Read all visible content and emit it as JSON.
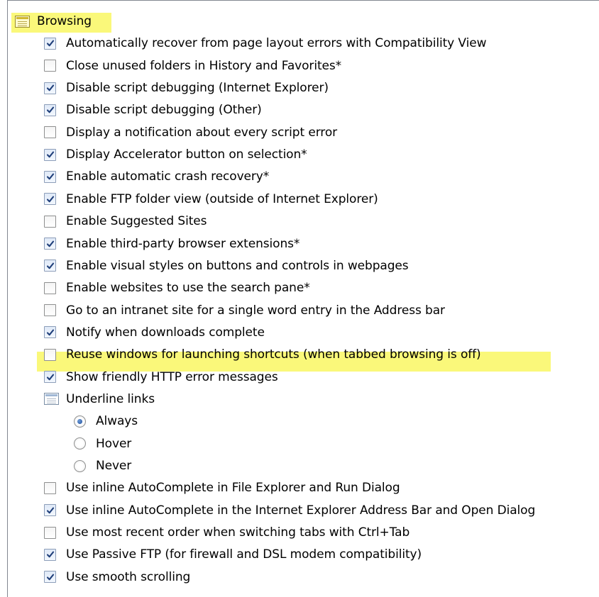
{
  "section": {
    "title": "Browsing",
    "items": [
      {
        "label": "Automatically recover from page layout errors with Compatibility View",
        "checked": true
      },
      {
        "label": "Close unused folders in History and Favorites*",
        "checked": false
      },
      {
        "label": "Disable script debugging (Internet Explorer)",
        "checked": true
      },
      {
        "label": "Disable script debugging (Other)",
        "checked": true
      },
      {
        "label": "Display a notification about every script error",
        "checked": false
      },
      {
        "label": "Display Accelerator button on selection*",
        "checked": true
      },
      {
        "label": "Enable automatic crash recovery*",
        "checked": true
      },
      {
        "label": "Enable FTP folder view (outside of Internet Explorer)",
        "checked": true
      },
      {
        "label": "Enable Suggested Sites",
        "checked": false
      },
      {
        "label": "Enable third-party browser extensions*",
        "checked": true
      },
      {
        "label": "Enable visual styles on buttons and controls in webpages",
        "checked": true
      },
      {
        "label": "Enable websites to use the search pane*",
        "checked": false
      },
      {
        "label": "Go to an intranet site for a single word entry in the Address bar",
        "checked": false
      },
      {
        "label": "Notify when downloads complete",
        "checked": true
      },
      {
        "label": "Reuse windows for launching shortcuts (when tabbed browsing is off)",
        "checked": false,
        "highlighted": true
      },
      {
        "label": "Show friendly HTTP error messages",
        "checked": true
      }
    ],
    "underline_group": {
      "title": "Underline links",
      "options": [
        {
          "label": "Always",
          "selected": true
        },
        {
          "label": "Hover",
          "selected": false
        },
        {
          "label": "Never",
          "selected": false
        }
      ]
    },
    "items_after": [
      {
        "label": "Use inline AutoComplete in File Explorer and Run Dialog",
        "checked": false
      },
      {
        "label": "Use inline AutoComplete in the Internet Explorer Address Bar and Open Dialog",
        "checked": true
      },
      {
        "label": "Use most recent order when switching tabs with Ctrl+Tab",
        "checked": false
      },
      {
        "label": "Use Passive FTP (for firewall and DSL modem compatibility)",
        "checked": true
      },
      {
        "label": "Use smooth scrolling",
        "checked": true
      }
    ]
  },
  "colors": {
    "highlight": "#faf87a",
    "check_mark": "#1f3f7a",
    "radio_dot": "#1f4f9a"
  },
  "icons": {
    "group_header": "settings-group-icon",
    "checkbox": "checkbox",
    "radio": "radio-button"
  }
}
